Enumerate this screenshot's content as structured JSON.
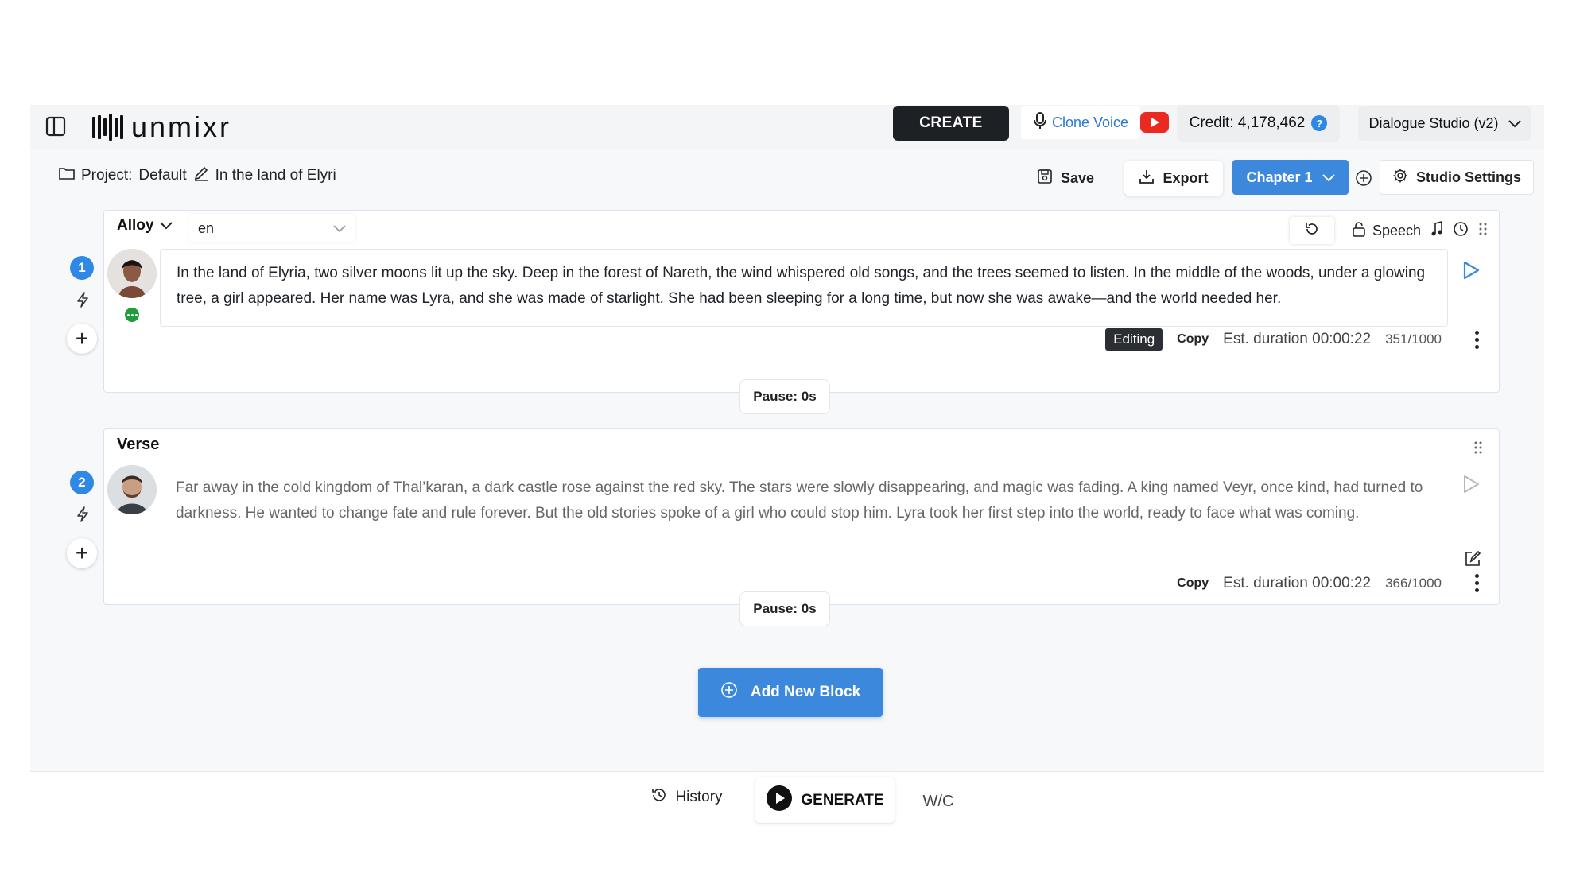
{
  "header": {
    "logo_text": "unmixr",
    "create_label": "CREATE",
    "clone_voice_label": "Clone Voice",
    "credit_label": "Credit: 4,178,462",
    "help_label": "?",
    "studio_label": "Dialogue Studio (v2)"
  },
  "project": {
    "label": "Project:",
    "name": "Default",
    "title": "In the land of Elyri",
    "save_label": "Save",
    "export_label": "Export",
    "chapter_label": "Chapter 1",
    "settings_label": "Studio Settings"
  },
  "blocks": [
    {
      "number": "1",
      "voice": "Alloy",
      "language": "en",
      "speech_label": "Speech",
      "text": "In the land of Elyria, two silver moons lit up the sky. Deep in the forest of Nareth, the wind whispered old songs, and the trees seemed to listen. In the middle of the woods, under a glowing tree, a girl appeared. Her name was Lyra, and she was made of starlight. She had been sleeping for a long time, but now she was awake—and the world needed her.",
      "status_badge": "Editing",
      "copy_label": "Copy",
      "duration": "Est. duration 00:00:22",
      "char_count": "351/1000",
      "pause": "Pause: 0s"
    },
    {
      "number": "2",
      "voice": "Verse",
      "text": "Far away in the cold kingdom of Thal’karan, a dark castle rose against the red sky. The stars were slowly disappearing, and magic was fading. A king named Veyr, once kind, had turned to darkness. He wanted to change fate and rule forever. But the old stories spoke of a girl who could stop him. Lyra took her first step into the world, ready to face what was coming.",
      "copy_label": "Copy",
      "duration": "Est. duration 00:00:22",
      "char_count": "366/1000",
      "pause": "Pause: 0s"
    }
  ],
  "add_block_label": "Add New Block",
  "footer": {
    "history_label": "History",
    "generate_label": "GENERATE",
    "wc_label": "W/C"
  },
  "colors": {
    "accent_blue": "#3b88dc",
    "create_dark": "#1d2126",
    "youtube_red": "#ea2a21",
    "status_green": "#1f9d3a"
  },
  "icons": [
    "sidebar-toggle-icon",
    "microphone-icon",
    "youtube-icon",
    "folder-icon",
    "pencil-icon",
    "save-icon",
    "download-icon",
    "chevron-down-icon",
    "plus-circle-icon",
    "gear-icon",
    "lightning-icon",
    "plus-icon",
    "undo-icon",
    "lock-icon",
    "music-note-icon",
    "history-icon",
    "drag-handle-icon",
    "play-icon",
    "edit-icon",
    "play-circle-icon"
  ]
}
